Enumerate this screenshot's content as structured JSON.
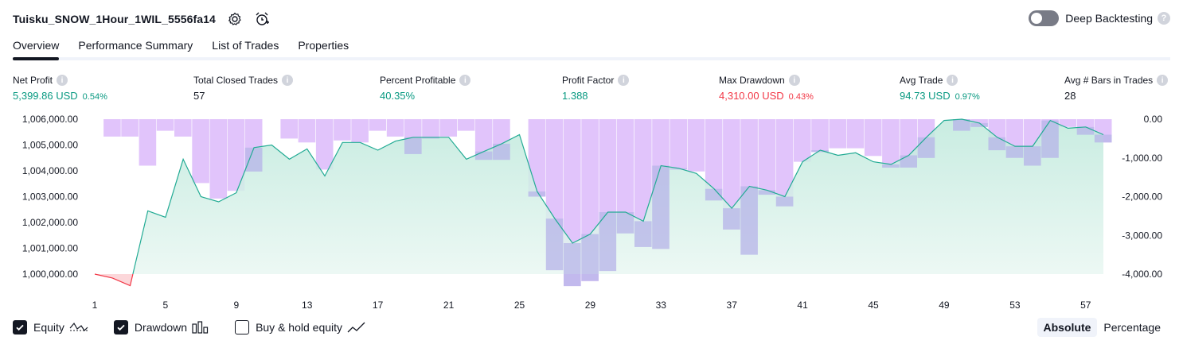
{
  "header": {
    "title": "Tuisku_SNOW_1Hour_1WIL_5556fa14",
    "deep_backtesting_label": "Deep Backtesting",
    "deep_backtesting_on": false
  },
  "tabs": [
    {
      "label": "Overview",
      "active": true
    },
    {
      "label": "Performance Summary",
      "active": false
    },
    {
      "label": "List of Trades",
      "active": false
    },
    {
      "label": "Properties",
      "active": false
    }
  ],
  "metrics": {
    "net_profit": {
      "label": "Net Profit",
      "value": "5,399.86 USD",
      "pct": "0.54%"
    },
    "total_closed_trades": {
      "label": "Total Closed Trades",
      "value": "57"
    },
    "percent_profitable": {
      "label": "Percent Profitable",
      "value": "40.35%"
    },
    "profit_factor": {
      "label": "Profit Factor",
      "value": "1.388"
    },
    "max_drawdown": {
      "label": "Max Drawdown",
      "value": "4,310.00 USD",
      "pct": "0.43%"
    },
    "avg_trade": {
      "label": "Avg Trade",
      "value": "94.73 USD",
      "pct": "0.97%"
    },
    "avg_bars": {
      "label": "Avg # Bars in Trades",
      "value": "28"
    }
  },
  "legend": {
    "equity": {
      "label": "Equity",
      "checked": true
    },
    "drawdown": {
      "label": "Drawdown",
      "checked": true
    },
    "buy_hold": {
      "label": "Buy & hold equity",
      "checked": false
    }
  },
  "mode": {
    "absolute": "Absolute",
    "percentage": "Percentage",
    "selected": "Absolute"
  },
  "colors": {
    "equity_line": "#22ab94",
    "equity_fill": "#d4f0e8",
    "equity_negative": "#f23645",
    "drawdown_bar": "#e1c4fb",
    "overlap_bar": "#b7b5e8",
    "positive": "#089981",
    "negative": "#f23645"
  },
  "chart_data": {
    "type": "line",
    "x_ticks": [
      1,
      5,
      9,
      13,
      17,
      21,
      25,
      29,
      33,
      37,
      41,
      45,
      49,
      53,
      57
    ],
    "left_axis_ticks": [
      "1,006,000.00",
      "1,005,000.00",
      "1,004,000.00",
      "1,003,000.00",
      "1,002,000.00",
      "1,001,000.00",
      "1,000,000.00"
    ],
    "right_axis_ticks": [
      "0.00",
      "-1,000.00",
      "-2,000.00",
      "-3,000.00",
      "-4,000.00"
    ],
    "equity_ylim": [
      1000000,
      1006000
    ],
    "drawdown_ylim": [
      -4000,
      0
    ],
    "series": [
      {
        "name": "Equity",
        "x": [
          1,
          2,
          3,
          4,
          5,
          6,
          7,
          8,
          9,
          10,
          11,
          12,
          13,
          14,
          15,
          16,
          17,
          18,
          19,
          20,
          21,
          22,
          23,
          24,
          25,
          26,
          27,
          28,
          29,
          30,
          31,
          32,
          33,
          34,
          35,
          36,
          37,
          38,
          39,
          40,
          41,
          42,
          43,
          44,
          45,
          46,
          47,
          48,
          49,
          50,
          51,
          52,
          53,
          54,
          55,
          56,
          57,
          58
        ],
        "values": [
          1000000,
          999850,
          999550,
          1002450,
          1002200,
          1004450,
          1003000,
          1002800,
          1003150,
          1004900,
          1005000,
          1004450,
          1004850,
          1003800,
          1005100,
          1005100,
          1004800,
          1005150,
          1005300,
          1005300,
          1005300,
          1004450,
          1004750,
          1005050,
          1005400,
          1003200,
          1002150,
          1001200,
          1001550,
          1002400,
          1002400,
          1002050,
          1004200,
          1004100,
          1003900,
          1003300,
          1002550,
          1003400,
          1003250,
          1003000,
          1004350,
          1004800,
          1004600,
          1004700,
          1004350,
          1004250,
          1004600,
          1005300,
          1005950,
          1006000,
          1005850,
          1005300,
          1004950,
          1004950,
          1005950,
          1005650,
          1005700,
          1005400
        ]
      },
      {
        "name": "Drawdown",
        "x": [
          1,
          2,
          3,
          4,
          5,
          6,
          7,
          8,
          9,
          10,
          11,
          12,
          13,
          14,
          15,
          16,
          17,
          18,
          19,
          20,
          21,
          22,
          23,
          24,
          25,
          26,
          27,
          28,
          29,
          30,
          31,
          32,
          33,
          34,
          35,
          36,
          37,
          38,
          39,
          40,
          41,
          42,
          43,
          44,
          45,
          46,
          47,
          48,
          49,
          50,
          51,
          52,
          53,
          54,
          55,
          56,
          57,
          58
        ],
        "values": [
          0,
          -450,
          -450,
          -1200,
          -300,
          -450,
          -1650,
          -2050,
          -1850,
          -1350,
          0,
          -500,
          -600,
          -1300,
          -550,
          -600,
          -300,
          -450,
          -900,
          -500,
          -450,
          -300,
          -1050,
          -1050,
          0,
          -2000,
          -3900,
          -4310,
          -4180,
          -3920,
          -2950,
          -3300,
          -3350,
          -1300,
          -1350,
          -2100,
          -2850,
          -3500,
          -1950,
          -2250,
          -1100,
          -850,
          -750,
          -750,
          -950,
          -1250,
          -1250,
          -1000,
          0,
          -300,
          -200,
          -800,
          -1000,
          -1200,
          -1000,
          -200,
          -400,
          -600
        ]
      }
    ]
  }
}
